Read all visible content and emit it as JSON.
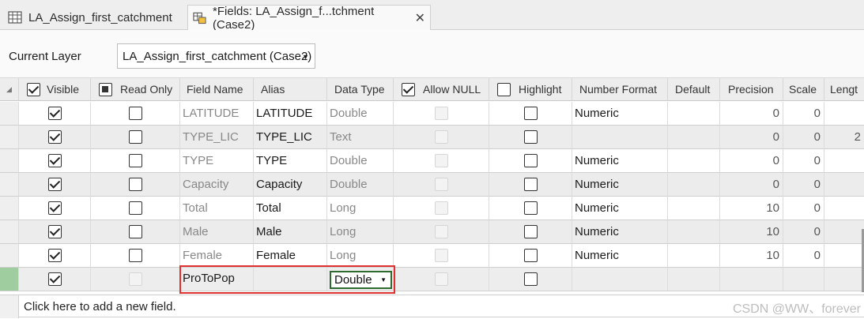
{
  "tabs": [
    {
      "label": "LA_Assign_first_catchment",
      "icon": "table-icon"
    },
    {
      "label": "*Fields: LA_Assign_f...tchment (Case2)",
      "icon": "fields-view-icon",
      "close": "✕"
    }
  ],
  "layer": {
    "label": "Current Layer",
    "value": "LA_Assign_first_catchment (Case2)"
  },
  "columns": {
    "visible": "Visible",
    "read_only": "Read Only",
    "field_name": "Field Name",
    "alias": "Alias",
    "data_type": "Data Type",
    "allow_null": "Allow NULL",
    "highlight": "Highlight",
    "number_format": "Number Format",
    "default": "Default",
    "precision": "Precision",
    "scale": "Scale",
    "length": "Lengt"
  },
  "header_checks": {
    "visible": true,
    "read_only": "indeterminate",
    "allow_null": true,
    "highlight": false
  },
  "rows": [
    {
      "field": "LATITUDE",
      "alias": "LATITUDE",
      "type": "Double",
      "format": "Numeric",
      "precision": "0",
      "scale": "0",
      "length": "",
      "visible": true
    },
    {
      "field": "TYPE_LIC",
      "alias": "TYPE_LIC",
      "type": "Text",
      "format": "",
      "precision": "0",
      "scale": "0",
      "length": "2",
      "visible": true
    },
    {
      "field": "TYPE",
      "alias": "TYPE",
      "type": "Double",
      "format": "Numeric",
      "precision": "0",
      "scale": "0",
      "length": "",
      "visible": true
    },
    {
      "field": "Capacity",
      "alias": "Capacity",
      "type": "Double",
      "format": "Numeric",
      "precision": "0",
      "scale": "0",
      "length": "",
      "visible": true
    },
    {
      "field": "Total",
      "alias": "Total",
      "type": "Long",
      "format": "Numeric",
      "precision": "10",
      "scale": "0",
      "length": "",
      "visible": true
    },
    {
      "field": "Male",
      "alias": "Male",
      "type": "Long",
      "format": "Numeric",
      "precision": "10",
      "scale": "0",
      "length": "",
      "visible": true
    },
    {
      "field": "Female",
      "alias": "Female",
      "type": "Long",
      "format": "Numeric",
      "precision": "10",
      "scale": "0",
      "length": "",
      "visible": true
    }
  ],
  "new_row": {
    "field": "ProToPop",
    "alias": "",
    "type": "Double",
    "visible": true
  },
  "footer": {
    "add_text": "Click here to add a new field."
  },
  "watermark": "CSDN @WW、forever",
  "colors": {
    "selection_marker": "#9fcd9f",
    "annotation_box": "#e03030",
    "select_border": "#2e6b2e"
  }
}
